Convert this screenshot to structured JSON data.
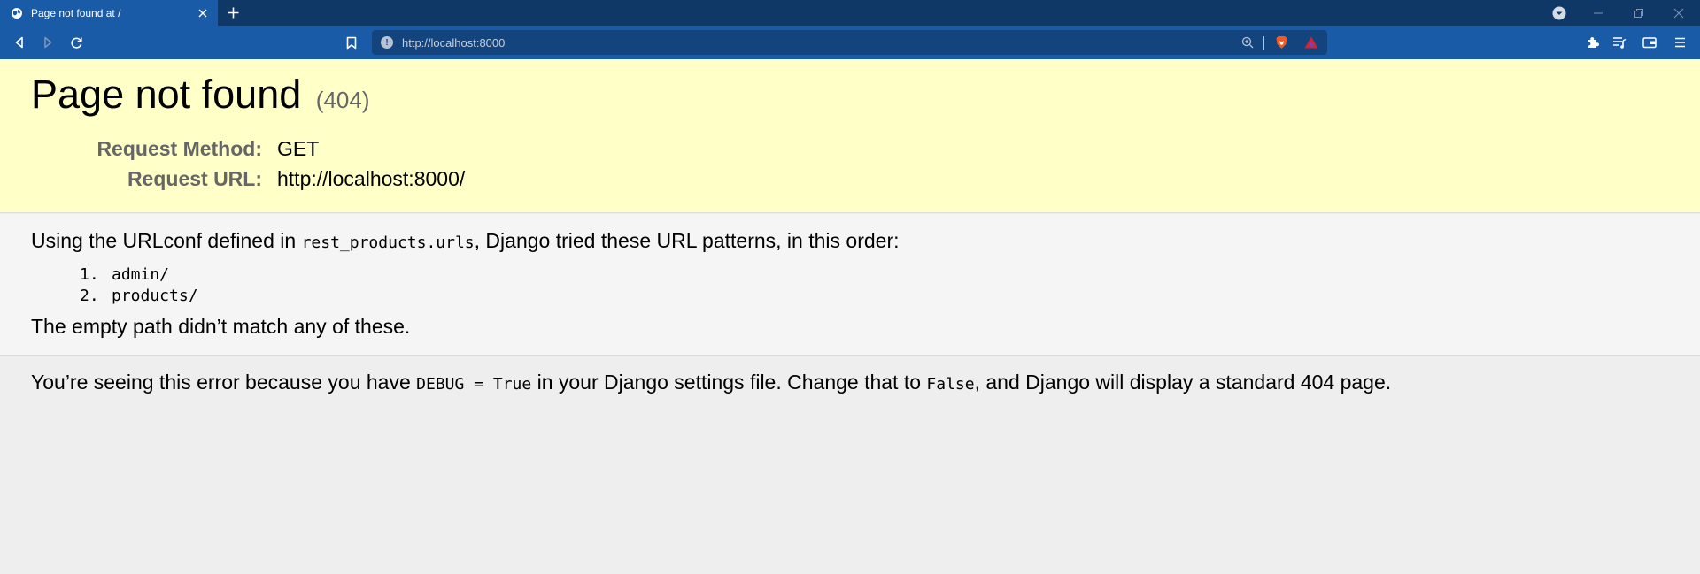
{
  "browser": {
    "tab": {
      "title": "Page not found at /"
    },
    "address_bar": {
      "url": "http://localhost:8000"
    }
  },
  "page": {
    "title": "Page not found",
    "code": "(404)",
    "request": {
      "method_label": "Request Method:",
      "method_value": "GET",
      "url_label": "Request URL:",
      "url_value": "http://localhost:8000/"
    },
    "info": {
      "prefix": "Using the URLconf defined in ",
      "urlconf": "rest_products.urls",
      "suffix": ", Django tried these URL patterns, in this order:",
      "patterns": [
        {
          "num": "1.",
          "pattern": "admin/"
        },
        {
          "num": "2.",
          "pattern": "products/"
        }
      ],
      "no_match": "The empty path didn’t match any of these."
    },
    "explanation": {
      "part1": "You’re seeing this error because you have ",
      "debug_code": "DEBUG = True",
      "part2": " in your Django settings file. Change that to ",
      "false_code": "False",
      "part3": ", and Django will display a standard 404 page."
    }
  },
  "icons": {
    "tab_favicon": "globe-icon",
    "tab_close": "close-icon",
    "new_tab": "plus-icon",
    "tab_search": "chevron-down-icon",
    "minimize": "minimize-icon",
    "restore": "restore-icon",
    "close_window": "close-icon",
    "back": "back-icon",
    "forward": "forward-icon",
    "reload": "reload-icon",
    "bookmark": "bookmark-icon",
    "site_info": "info-icon",
    "zoom": "zoom-icon",
    "brave_shields": "brave-lion-icon",
    "brave_rewards": "triangle-icon",
    "extensions": "puzzle-icon",
    "playlist": "playlist-icon",
    "wallet": "wallet-icon",
    "menu": "menu-icon"
  },
  "colors": {
    "tabbar_bg": "#0f3866",
    "toolbar_bg": "#1a5ba8",
    "summary_bg": "#ffffc8",
    "info_bg": "#f5f5f5",
    "explanation_bg": "#eeeeee",
    "label_gray": "#666666"
  }
}
